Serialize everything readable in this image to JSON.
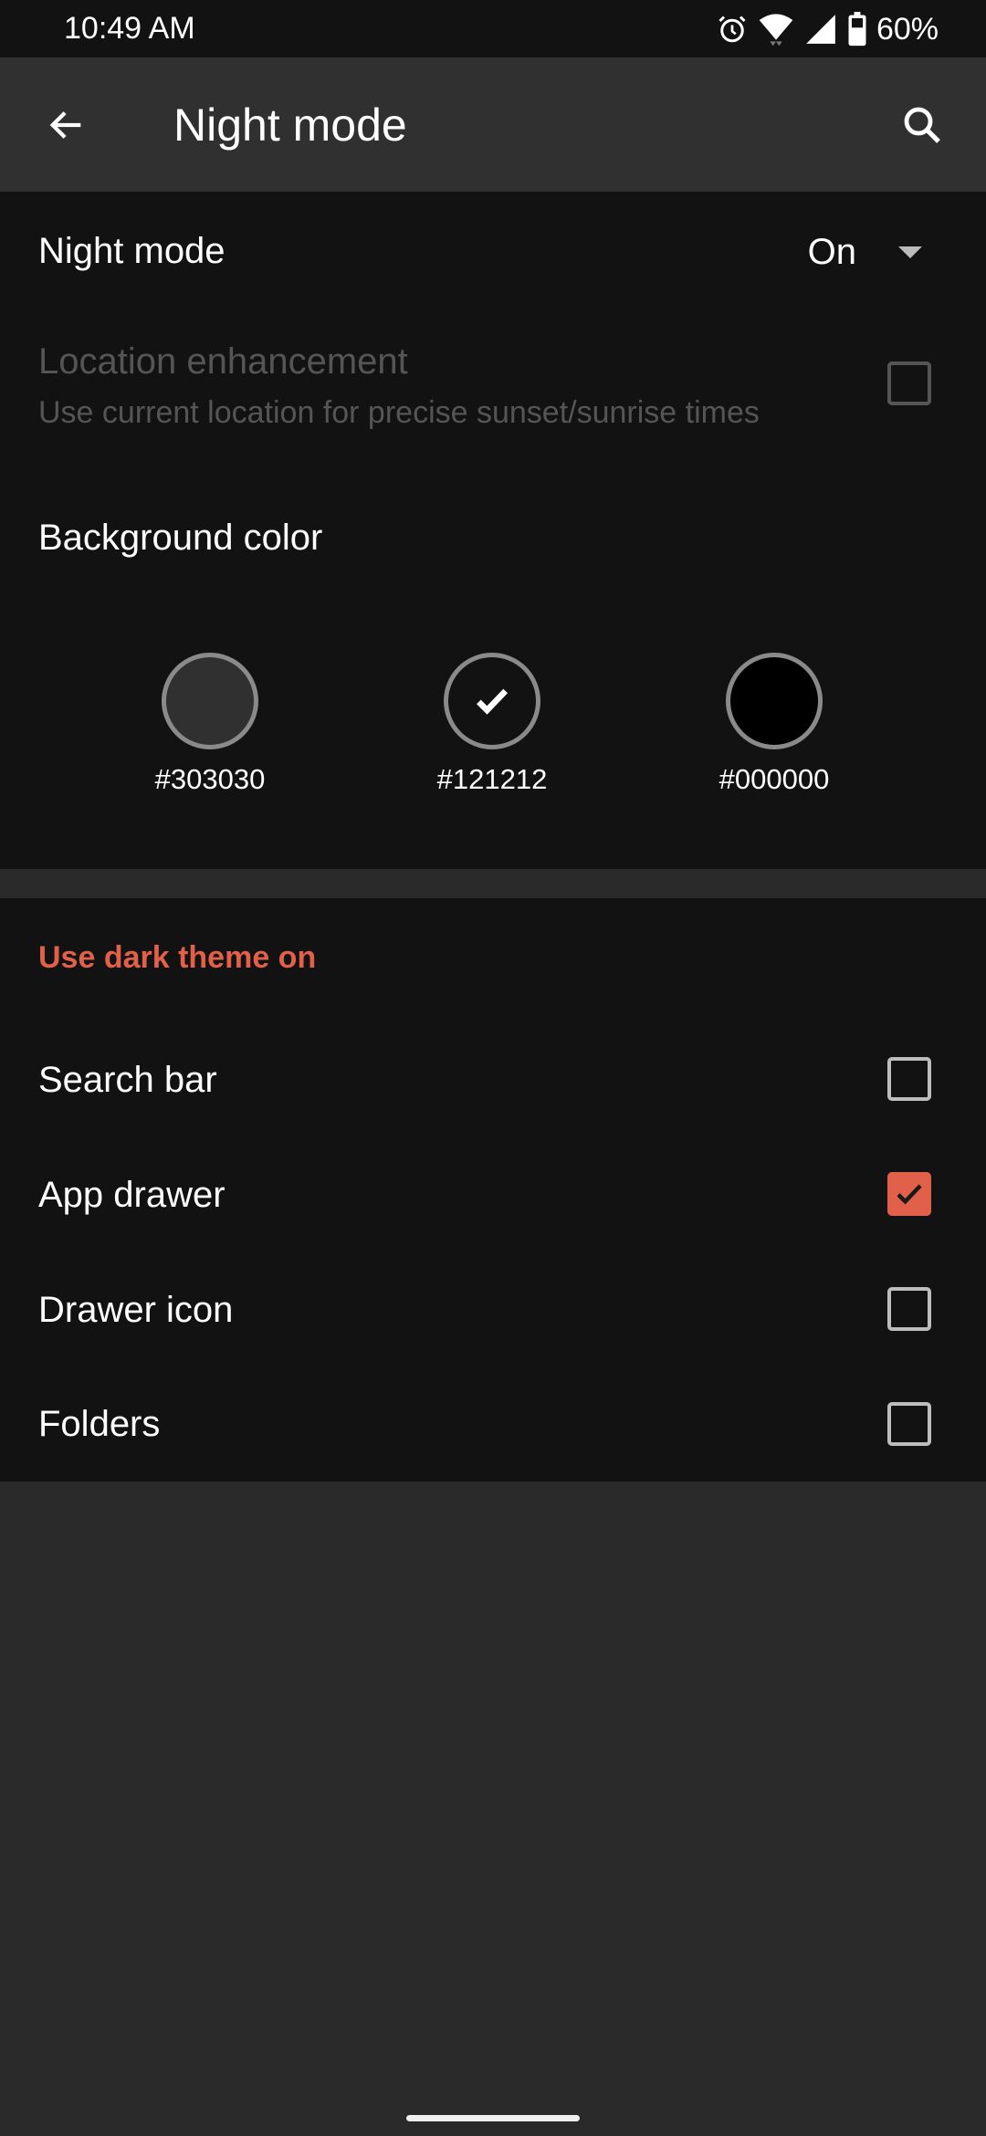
{
  "status_bar": {
    "time": "10:49 AM",
    "battery": "60%",
    "icons": [
      "alarm-icon",
      "wifi-icon",
      "signal-icon",
      "battery-icon"
    ]
  },
  "app_bar": {
    "title": "Night mode",
    "back_icon": "arrow-left-icon",
    "search_icon": "search-icon"
  },
  "settings": {
    "night_mode": {
      "label": "Night mode",
      "value": "On"
    },
    "location": {
      "title": "Location enhancement",
      "subtitle": "Use current location for precise sunset/sunrise times",
      "checked": false,
      "enabled": false
    },
    "background_color": {
      "label": "Background color",
      "options": [
        {
          "label": "#303030",
          "color": "#303030",
          "selected": false
        },
        {
          "label": "#121212",
          "color": "#121212",
          "selected": true
        },
        {
          "label": "#000000",
          "color": "#000000",
          "selected": false
        }
      ]
    }
  },
  "dark_theme": {
    "header": "Use dark theme on",
    "items": [
      {
        "label": "Search bar",
        "checked": false
      },
      {
        "label": "App drawer",
        "checked": true
      },
      {
        "label": "Drawer icon",
        "checked": false
      },
      {
        "label": "Folders",
        "checked": false
      }
    ]
  },
  "colors": {
    "accent": "#e0604a",
    "app_bar": "#303030",
    "surface": "#121212",
    "background": "#2a2a2a"
  }
}
